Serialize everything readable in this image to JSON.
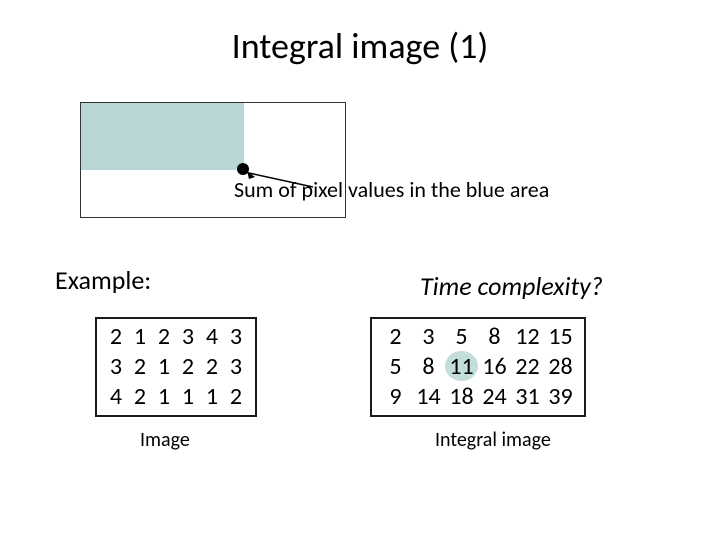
{
  "title": "Integral image (1)",
  "sum_label": "Sum of pixel values in the blue area",
  "example_label": "Example:",
  "time_label": "Time complexity?",
  "image_caption": "Image",
  "integral_caption": "Integral image",
  "image_table": {
    "rows": [
      [
        "2",
        "1",
        "2",
        "3",
        "4",
        "3"
      ],
      [
        "3",
        "2",
        "1",
        "2",
        "2",
        "3"
      ],
      [
        "4",
        "2",
        "1",
        "1",
        "1",
        "2"
      ]
    ]
  },
  "integral_table": {
    "rows": [
      [
        "2",
        "3",
        "5",
        "8",
        "12",
        "15"
      ],
      [
        "5",
        "8",
        "11",
        "16",
        "22",
        "28"
      ],
      [
        "9",
        "14",
        "18",
        "24",
        "31",
        "39"
      ]
    ],
    "highlight": [
      1,
      2
    ]
  }
}
